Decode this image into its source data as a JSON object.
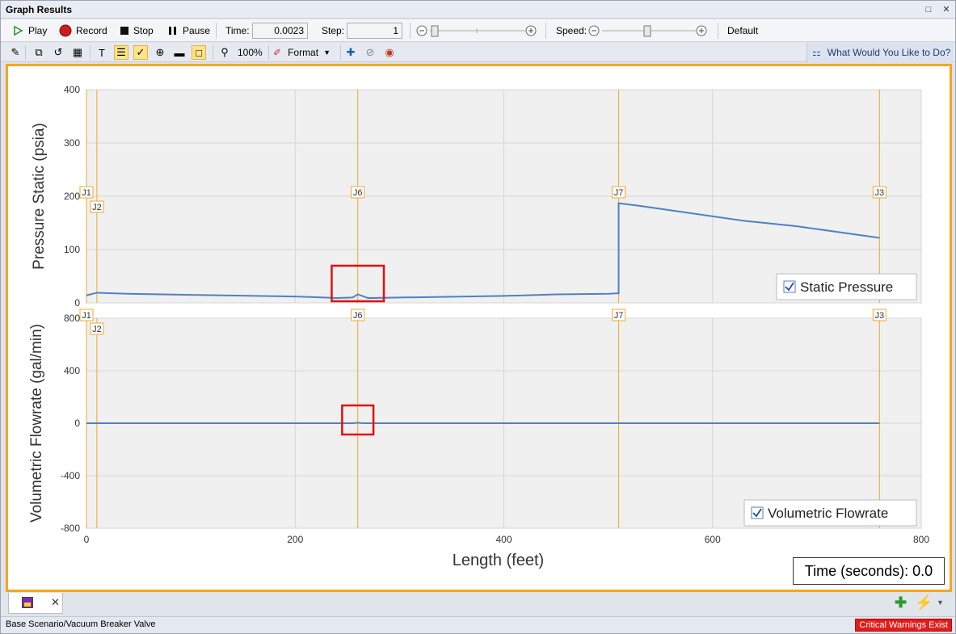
{
  "window": {
    "title": "Graph Results"
  },
  "playback": {
    "play": "Play",
    "record": "Record",
    "stop": "Stop",
    "pause": "Pause",
    "time_label": "Time:",
    "time_value": "0.0023",
    "step_label": "Step:",
    "step_value": "1",
    "speed_label": "Speed:",
    "speed_default": "Default"
  },
  "toolbar2": {
    "zoom_label": "100%",
    "format_label": "Format",
    "help_label": "What Would You Like to Do?"
  },
  "colors": {
    "accent_border": "#f5a623",
    "junction_line": "#f0a830",
    "series": "#4f81c4",
    "highlight_box": "#e01010",
    "warning_bg": "#e31b1b"
  },
  "chart_data": [
    {
      "type": "line",
      "ylabel": "Pressure Static (psia)",
      "ylim": [
        0,
        400
      ],
      "yticks": [
        0,
        100,
        200,
        300,
        400
      ],
      "xlim": [
        0,
        800
      ],
      "legend": "Static Pressure",
      "legend_position": "bottom-right",
      "junction_labels": [
        {
          "name": "J1",
          "x": 0
        },
        {
          "name": "J2",
          "x": 10
        },
        {
          "name": "J6",
          "x": 260
        },
        {
          "name": "J7",
          "x": 510
        },
        {
          "name": "J3",
          "x": 760
        }
      ],
      "series": [
        {
          "name": "Static Pressure",
          "x": [
            0,
            10,
            40,
            100,
            200,
            240,
            255,
            260,
            270,
            300,
            400,
            450,
            500,
            510,
            510,
            530,
            580,
            630,
            680,
            720,
            760
          ],
          "y": [
            14,
            19,
            17,
            15,
            12,
            9,
            10,
            16,
            9,
            10,
            13,
            16,
            17,
            18,
            187,
            182,
            168,
            154,
            144,
            133,
            122
          ]
        }
      ],
      "highlight": {
        "x_range": [
          235,
          285
        ]
      }
    },
    {
      "type": "line",
      "ylabel": "Volumetric Flowrate (gal/min)",
      "xlabel": "Length (feet)",
      "ylim": [
        -800,
        800
      ],
      "yticks": [
        -800,
        -400,
        0,
        400,
        800
      ],
      "xlim": [
        0,
        800
      ],
      "xticks": [
        0,
        200,
        400,
        600,
        800
      ],
      "legend": "Volumetric Flowrate",
      "legend_position": "bottom-right",
      "junction_labels": [
        {
          "name": "J1",
          "x": 0
        },
        {
          "name": "J2",
          "x": 10
        },
        {
          "name": "J6",
          "x": 260
        },
        {
          "name": "J7",
          "x": 510
        },
        {
          "name": "J3",
          "x": 760
        }
      ],
      "series": [
        {
          "name": "Volumetric Flowrate",
          "x": [
            0,
            255,
            260,
            265,
            760
          ],
          "y": [
            0,
            0,
            3,
            0,
            0
          ]
        }
      ],
      "highlight": {
        "x_range": [
          245,
          275
        ]
      }
    }
  ],
  "time_readout": "Time (seconds): 0.0",
  "status": {
    "scenario": "Base Scenario/Vacuum Breaker Valve",
    "warning": "Critical Warnings Exist"
  }
}
